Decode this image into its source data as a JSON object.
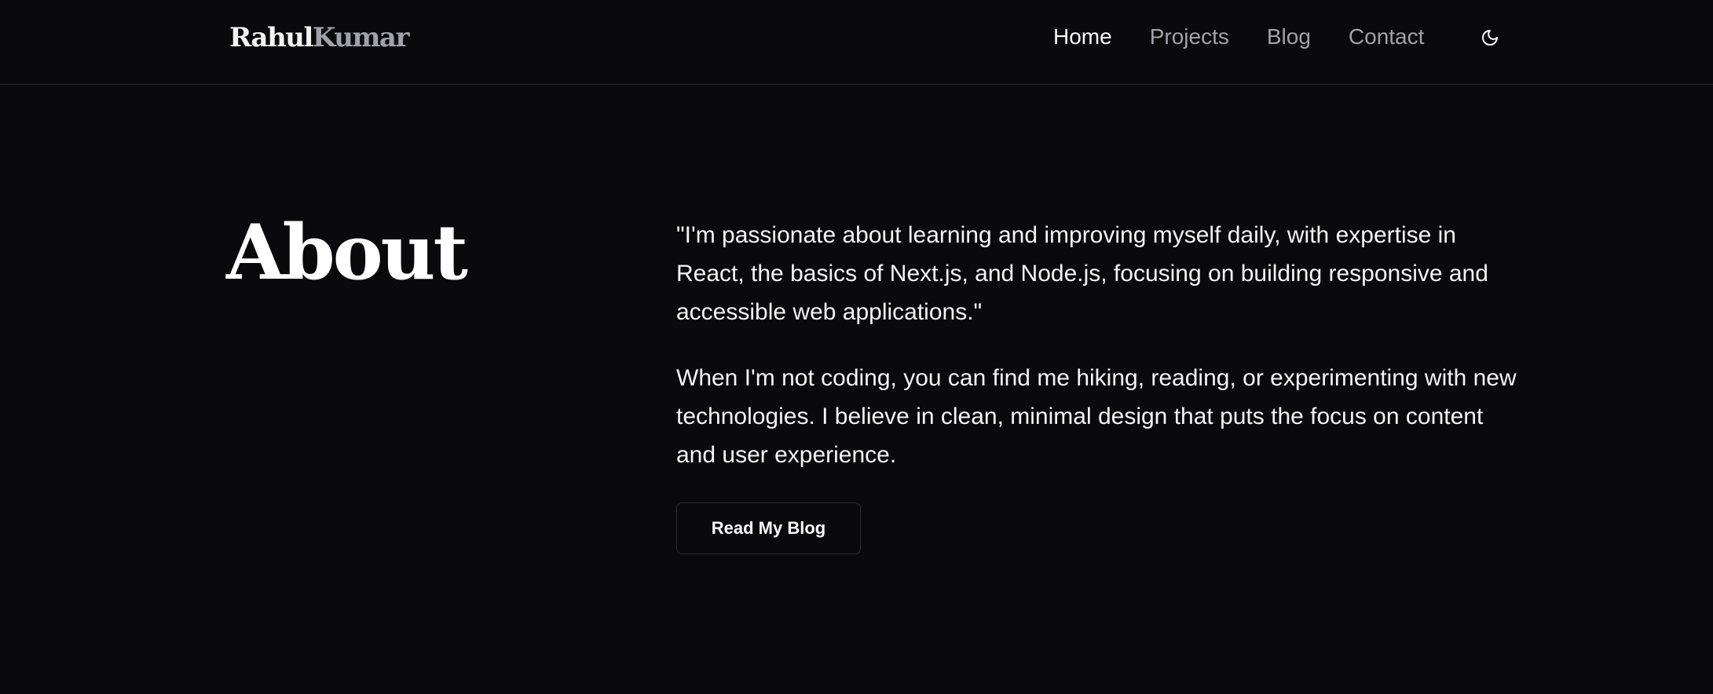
{
  "header": {
    "logo": {
      "first": "Rahul",
      "last": "Kumar"
    },
    "nav": [
      {
        "label": "Home",
        "active": true
      },
      {
        "label": "Projects",
        "active": false
      },
      {
        "label": "Blog",
        "active": false
      },
      {
        "label": "Contact",
        "active": false
      }
    ],
    "theme_toggle_icon": "moon-icon"
  },
  "about": {
    "title": "About",
    "paragraphs": [
      "\"I'm passionate about learning and improving myself daily, with expertise in React, the basics of Next.js, and Node.js, focusing on building responsive and accessible web applications.\"",
      "When I'm not coding, you can find me hiking, reading, or experimenting with new technologies. I believe in clean, minimal design that puts the focus on content and user experience."
    ],
    "cta_label": "Read My Blog"
  },
  "colors": {
    "background": "#0a0a0c",
    "text": "#fafafa",
    "muted": "#a1a1aa",
    "border": "#26262a"
  }
}
